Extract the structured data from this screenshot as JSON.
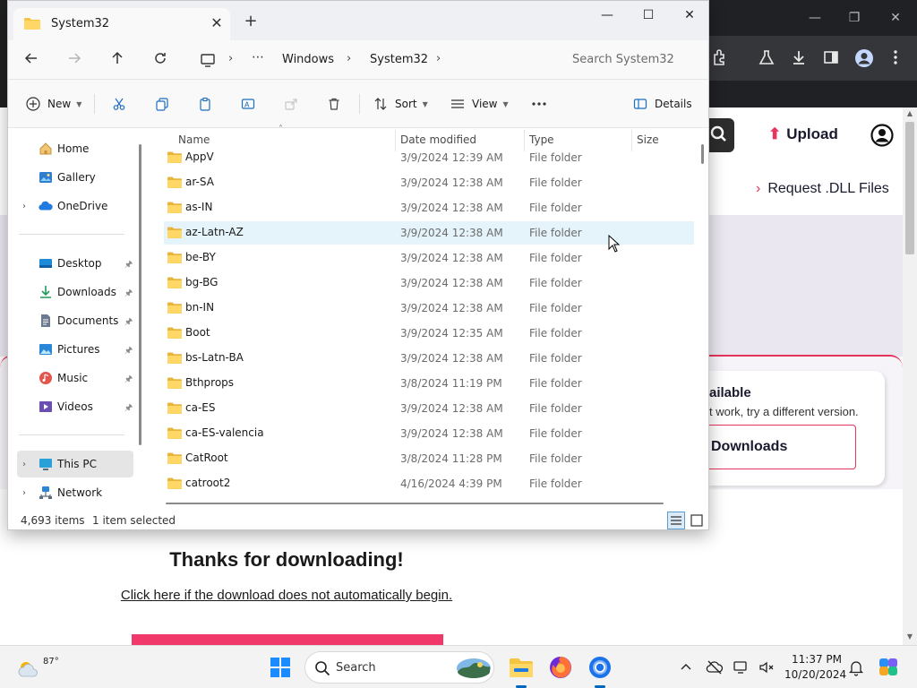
{
  "explorer": {
    "tab_title": "System32",
    "breadcrumbs": [
      "Windows",
      "System32"
    ],
    "search_placeholder": "Search System32",
    "toolbar": {
      "new_label": "New",
      "sort_label": "Sort",
      "view_label": "View",
      "details_label": "Details"
    },
    "nav": {
      "home": "Home",
      "gallery": "Gallery",
      "onedrive": "OneDrive",
      "desktop": "Desktop",
      "downloads": "Downloads",
      "documents": "Documents",
      "pictures": "Pictures",
      "music": "Music",
      "videos": "Videos",
      "this_pc": "This PC",
      "network": "Network"
    },
    "columns": {
      "name": "Name",
      "date": "Date modified",
      "type": "Type",
      "size": "Size"
    },
    "files": [
      {
        "name": "AppV",
        "date": "3/9/2024 12:39 AM",
        "type": "File folder"
      },
      {
        "name": "ar-SA",
        "date": "3/9/2024 12:38 AM",
        "type": "File folder"
      },
      {
        "name": "as-IN",
        "date": "3/9/2024 12:38 AM",
        "type": "File folder"
      },
      {
        "name": "az-Latn-AZ",
        "date": "3/9/2024 12:38 AM",
        "type": "File folder"
      },
      {
        "name": "be-BY",
        "date": "3/9/2024 12:38 AM",
        "type": "File folder"
      },
      {
        "name": "bg-BG",
        "date": "3/9/2024 12:38 AM",
        "type": "File folder"
      },
      {
        "name": "bn-IN",
        "date": "3/9/2024 12:38 AM",
        "type": "File folder"
      },
      {
        "name": "Boot",
        "date": "3/9/2024 12:35 AM",
        "type": "File folder"
      },
      {
        "name": "bs-Latn-BA",
        "date": "3/9/2024 12:38 AM",
        "type": "File folder"
      },
      {
        "name": "Bthprops",
        "date": "3/8/2024 11:19 PM",
        "type": "File folder"
      },
      {
        "name": "ca-ES",
        "date": "3/9/2024 12:38 AM",
        "type": "File folder"
      },
      {
        "name": "ca-ES-valencia",
        "date": "3/9/2024 12:38 AM",
        "type": "File folder"
      },
      {
        "name": "CatRoot",
        "date": "3/8/2024 11:28 PM",
        "type": "File folder"
      },
      {
        "name": "catroot2",
        "date": "4/16/2024 4:39 PM",
        "type": "File folder"
      }
    ],
    "status": {
      "items": "4,693 items",
      "selected": "1 item selected"
    }
  },
  "browser": {
    "upload_label": "Upload",
    "request_link": "Request .DLL Files",
    "alt_title": "ailable",
    "alt_subtitle": "t work, try a different version.",
    "alt_button": "Downloads",
    "thanks": "Thanks for downloading!",
    "click_here": "Click here if the download does not automatically begin."
  },
  "taskbar": {
    "weather_temp": "87°",
    "search_label": "Search",
    "time": "11:37 PM",
    "date": "10/20/2024"
  },
  "colors": {
    "accent": "#0067c0",
    "brand_pink": "#e6345c",
    "folder": "#f5c542",
    "hover_row": "#e5f3fb"
  }
}
